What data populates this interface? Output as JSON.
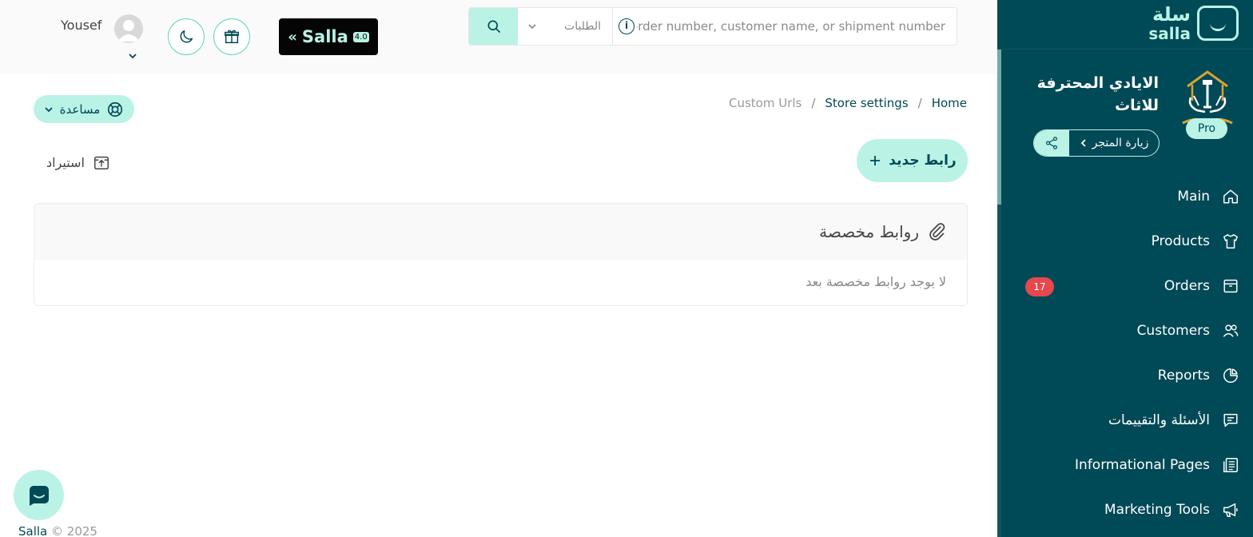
{
  "sidebar": {
    "logo_ar": "سلة",
    "logo_en": "salla",
    "store_name": "الايادي المحترفة للاثاث",
    "pro_label": "Pro",
    "visit_store_label": "زيارة المتجر",
    "items": [
      {
        "label": "Main",
        "icon": "home-icon"
      },
      {
        "label": "Products",
        "icon": "shirt-icon"
      },
      {
        "label": "Orders",
        "icon": "box-icon",
        "badge": "17"
      },
      {
        "label": "Customers",
        "icon": "users-icon"
      },
      {
        "label": "Reports",
        "icon": "pie-chart-icon"
      },
      {
        "label": "الأسئلة والتقييمات",
        "icon": "comment-icon"
      },
      {
        "label": "Informational Pages",
        "icon": "pages-icon"
      },
      {
        "label": "Marketing Tools",
        "icon": "megaphone-icon"
      }
    ]
  },
  "header": {
    "user_name": "Yousef",
    "banner_word": "Salla",
    "banner_version": "4.0",
    "search": {
      "placeholder": "Search by order number, customer name, or shipment number",
      "scope": "الطلبات"
    }
  },
  "breadcrumb": {
    "home": "Home",
    "store_settings": "Store settings",
    "current": "Custom Urls",
    "separator": "/"
  },
  "main": {
    "help_label": "مساعدة",
    "add_link_label": "رابط جديد",
    "import_label": "استيراد",
    "card_title": "روابط مخصصة",
    "empty_text": "لا يوجد روابط مخصصة بعد"
  },
  "footer": {
    "brand": "Salla",
    "copyright": "© 2025"
  },
  "colors": {
    "primary": "#004956",
    "accent": "#baf3e6",
    "badge": "#e5484d"
  }
}
